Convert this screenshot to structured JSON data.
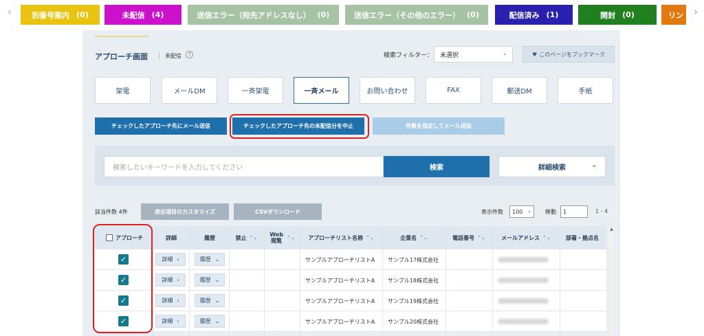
{
  "status_tabs": [
    {
      "label": "別番号案内",
      "count": "(0)",
      "color": "#e8c410"
    },
    {
      "label": "未配信",
      "count": "(4)",
      "color": "#cc11cc"
    },
    {
      "label": "送信エラー（宛先アドレスなし）",
      "count": "(0)",
      "color": "#a6c3a4"
    },
    {
      "label": "送信エラー（その他のエラー）",
      "count": "(0)",
      "color": "#a6c3a4"
    },
    {
      "label": "配信済み",
      "count": "(1)",
      "color": "#2a20b0"
    },
    {
      "label": "開封",
      "count": "(0)",
      "color": "#208020"
    },
    {
      "label": "リン",
      "count": "",
      "color": "#e07a10"
    }
  ],
  "header": {
    "title": "アプローチ画面",
    "crumb": "未配信",
    "help": "?",
    "filter_label": "検索フィルター：",
    "filter_value": "未選択",
    "bookmark_label": "このページをブックマーク"
  },
  "channels": [
    {
      "label": "架電",
      "active": false
    },
    {
      "label": "メールDM",
      "active": false
    },
    {
      "label": "一斉架電",
      "active": false
    },
    {
      "label": "一斉メール",
      "active": true
    },
    {
      "label": "お問い合わせ",
      "active": false
    },
    {
      "label": "FAX",
      "active": false
    },
    {
      "label": "郵送DM",
      "active": false
    },
    {
      "label": "手紙",
      "active": false
    }
  ],
  "actions": {
    "send_checked": "チェックしたアプローチ先にメール送信",
    "cancel_undelivered": "チェックしたアプローチ先の未配信分を中止",
    "send_by_count": "件数を指定してメール送信"
  },
  "search": {
    "placeholder": "検索したいキーワードを入力してください",
    "button": "検索",
    "detail_button": "詳細検索"
  },
  "list": {
    "count_label": "該当件数 4件",
    "customize_button": "表示項目のカスタマイズ",
    "csv_button": "CSVダウンロード",
    "per_page_label": "表示件数",
    "per_page_value": "100",
    "move_label": "移動",
    "move_value": "1",
    "range": "1 - 4"
  },
  "table": {
    "headers": {
      "approach": "アプローチ",
      "detail": "詳細",
      "history": "履歴",
      "ban": "禁止",
      "web": "Web閲覧",
      "list_name": "アプローチリスト名称",
      "company": "企業名",
      "phone": "電話番号",
      "email": "メールアドレス",
      "dept": "部署・拠点名"
    },
    "detail_btn": "詳細",
    "history_btn": "履歴",
    "rows": [
      {
        "list_name": "サンプルアプローチリストA",
        "company": "サンプル17株式会社",
        "checked": true
      },
      {
        "list_name": "サンプルアプローチリストA",
        "company": "サンプル18株式会社",
        "checked": true
      },
      {
        "list_name": "サンプルアプローチリストA",
        "company": "サンプル19株式会社",
        "checked": true
      },
      {
        "list_name": "サンプルアプローチリストA",
        "company": "サンプル20株式会社",
        "checked": true
      }
    ]
  }
}
